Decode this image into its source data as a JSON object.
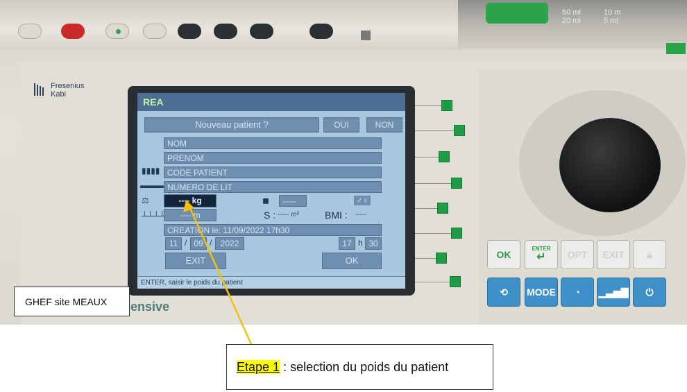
{
  "annotation": {
    "site_label": "GHEF site MEAUX",
    "step_label": "Etape 1",
    "step_text": " : selection du poids du patient",
    "highlight_color": "#ffff00",
    "arrow_color": "#f5c10e"
  },
  "device": {
    "brand_line1": "Fresenius",
    "brand_line2": "Kabi",
    "model_partial": "ensive",
    "top_scale": [
      "50 ml",
      "20 ml",
      "10 m",
      "5 ml"
    ],
    "accent_green": "#1f9b45"
  },
  "screen": {
    "header_title": "REA",
    "prompt": "Nouveau patient ?",
    "yes_button": "OUI",
    "no_button": "NON",
    "fields": {
      "nom": "NOM",
      "prenom": "PRENOM",
      "code_patient": "CODE PATIENT",
      "numero_lit": "NUMERO DE LIT"
    },
    "weight_value": "---- kg",
    "height_value": "---- m",
    "extra_value": "-----",
    "surface_label": "S :",
    "surface_value": "----- m²",
    "bmi_label": "BMI :",
    "bmi_value": "-----",
    "creation_text": "CREATION le: 11/09/2022 17h30",
    "date": {
      "day": "11",
      "month": "09",
      "year": "2022",
      "hour": "17",
      "h_sep": "h",
      "minute": "30",
      "sep": "/"
    },
    "exit_button": "EXIT",
    "ok_button": "OK",
    "status_text": "ENTER, saisir le poids du patient"
  },
  "keys": {
    "ok": "OK",
    "enter": "ENTER",
    "opt": "OPT",
    "exit": "EXIT",
    "mode": "MODE"
  }
}
